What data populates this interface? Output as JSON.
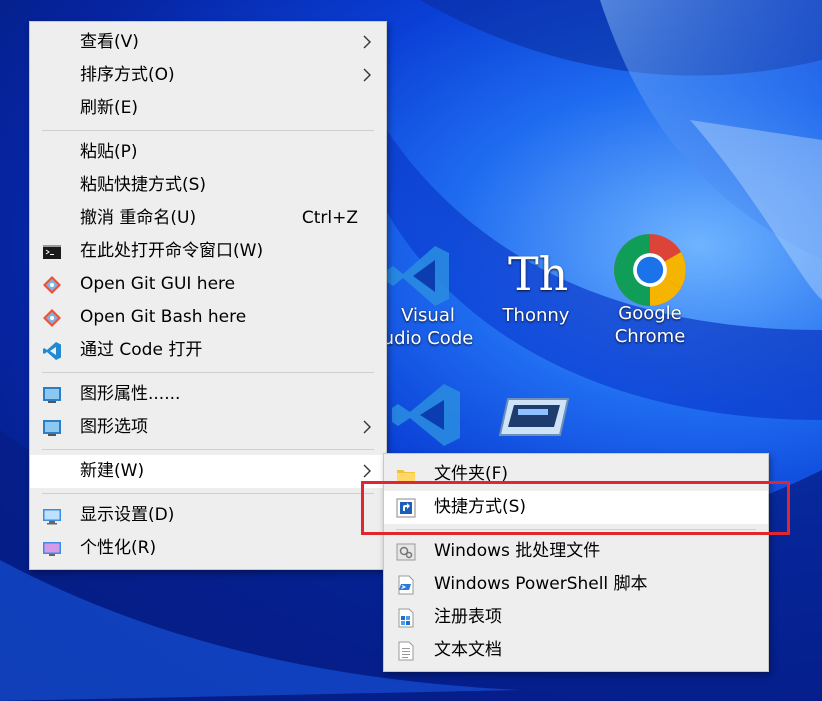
{
  "desktop": {
    "icons": [
      {
        "name": "vscode",
        "label_line1": "Visual",
        "label_line2": "udio Code"
      },
      {
        "name": "thonny",
        "label_line1": "Thonny",
        "label_line2": ""
      },
      {
        "name": "chrome",
        "label_line1": "Google",
        "label_line2": "Chrome"
      }
    ]
  },
  "context_menu": {
    "items": [
      {
        "label": "查看(V)",
        "icon": "",
        "submenu": true
      },
      {
        "label": "排序方式(O)",
        "icon": "",
        "submenu": true
      },
      {
        "label": "刷新(E)",
        "icon": ""
      },
      {
        "label": "粘贴(P)",
        "icon": ""
      },
      {
        "label": "粘贴快捷方式(S)",
        "icon": ""
      },
      {
        "label": "撤消 重命名(U)",
        "icon": "",
        "shortcut": "Ctrl+Z"
      },
      {
        "label": "在此处打开命令窗口(W)",
        "icon": "cmd-icon"
      },
      {
        "label": "Open Git GUI here",
        "icon": "git-gui-icon"
      },
      {
        "label": "Open Git Bash here",
        "icon": "git-bash-icon"
      },
      {
        "label": "通过 Code 打开",
        "icon": "vscode-icon"
      },
      {
        "label": "图形属性......",
        "icon": "intel-graphics-icon"
      },
      {
        "label": "图形选项",
        "icon": "intel-graphics-icon",
        "submenu": true
      },
      {
        "label": "新建(W)",
        "icon": "",
        "submenu": true,
        "active": true
      },
      {
        "label": "显示设置(D)",
        "icon": "display-icon"
      },
      {
        "label": "个性化(R)",
        "icon": "personalize-icon"
      }
    ]
  },
  "new_submenu": {
    "items": [
      {
        "label": "文件夹(F)",
        "icon": "folder-icon"
      },
      {
        "label": "快捷方式(S)",
        "icon": "shortcut-icon",
        "highlighted": true
      },
      {
        "label": "Windows 批处理文件",
        "icon": "batch-file-icon"
      },
      {
        "label": "Windows PowerShell 脚本",
        "icon": "powershell-icon"
      },
      {
        "label": "注册表项",
        "icon": "registry-icon"
      },
      {
        "label": "文本文档",
        "icon": "text-document-icon"
      }
    ]
  },
  "colors": {
    "highlight_border": "#e0262e",
    "menu_bg": "#eeeeee"
  }
}
